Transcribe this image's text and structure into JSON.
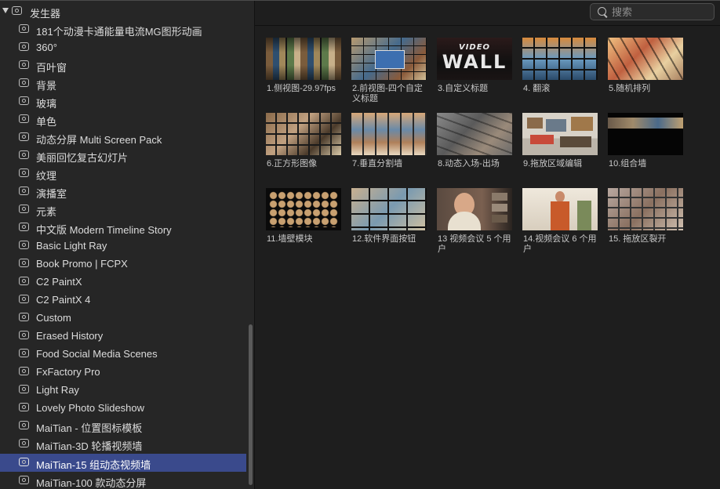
{
  "sidebar": {
    "root_label": "发生器",
    "items": [
      {
        "label": "181个动漫卡通能量电流MG图形动画"
      },
      {
        "label": "360°"
      },
      {
        "label": "百叶窗"
      },
      {
        "label": "背景"
      },
      {
        "label": "玻璃"
      },
      {
        "label": "单色"
      },
      {
        "label": "动态分屏 Multi Screen Pack"
      },
      {
        "label": "美丽回忆复古幻灯片"
      },
      {
        "label": "纹理"
      },
      {
        "label": "演播室"
      },
      {
        "label": "元素"
      },
      {
        "label": "中文版 Modern Timeline Story"
      },
      {
        "label": "Basic Light Ray"
      },
      {
        "label": "Book Promo | FCPX"
      },
      {
        "label": "C2 PaintX"
      },
      {
        "label": "C2 PaintX 4"
      },
      {
        "label": "Custom"
      },
      {
        "label": "Erased History"
      },
      {
        "label": "Food Social Media Scenes"
      },
      {
        "label": "FxFactory Pro"
      },
      {
        "label": "Light Ray"
      },
      {
        "label": "Lovely Photo Slideshow"
      },
      {
        "label": "MaiTian - 位置图标模板"
      },
      {
        "label": "MaiTian-3D 轮播视频墙"
      },
      {
        "label": "MaiTian-15 组动态视频墙",
        "selected": true
      },
      {
        "label": "MaiTian-100 款动态分屏"
      }
    ]
  },
  "search": {
    "placeholder": "搜索",
    "value": ""
  },
  "thumbnail_overlay": {
    "video_text": "VIDEO",
    "wall_text": "WALL"
  },
  "grid": {
    "items": [
      {
        "label": "1.侧视图-29.97fps"
      },
      {
        "label": "2.前视图-四个自定义标题"
      },
      {
        "label": "3.自定义标题"
      },
      {
        "label": "4. 翻滚"
      },
      {
        "label": "5.随机排列"
      },
      {
        "label": "6.正方形图像"
      },
      {
        "label": "7.垂直分割墙"
      },
      {
        "label": "8.动态入场-出场"
      },
      {
        "label": "9.拖放区域编辑"
      },
      {
        "label": "10.组合墙"
      },
      {
        "label": "11.墙壁模块"
      },
      {
        "label": "12.软件界面按钮"
      },
      {
        "label": "13 视频会议 5 个用户"
      },
      {
        "label": "14.视频会议 6 个用户"
      },
      {
        "label": "15. 拖放区裂开"
      }
    ]
  },
  "colors": {
    "selection": "#3a4a8c",
    "background": "#1e1e1e",
    "sidebar": "#262626"
  }
}
